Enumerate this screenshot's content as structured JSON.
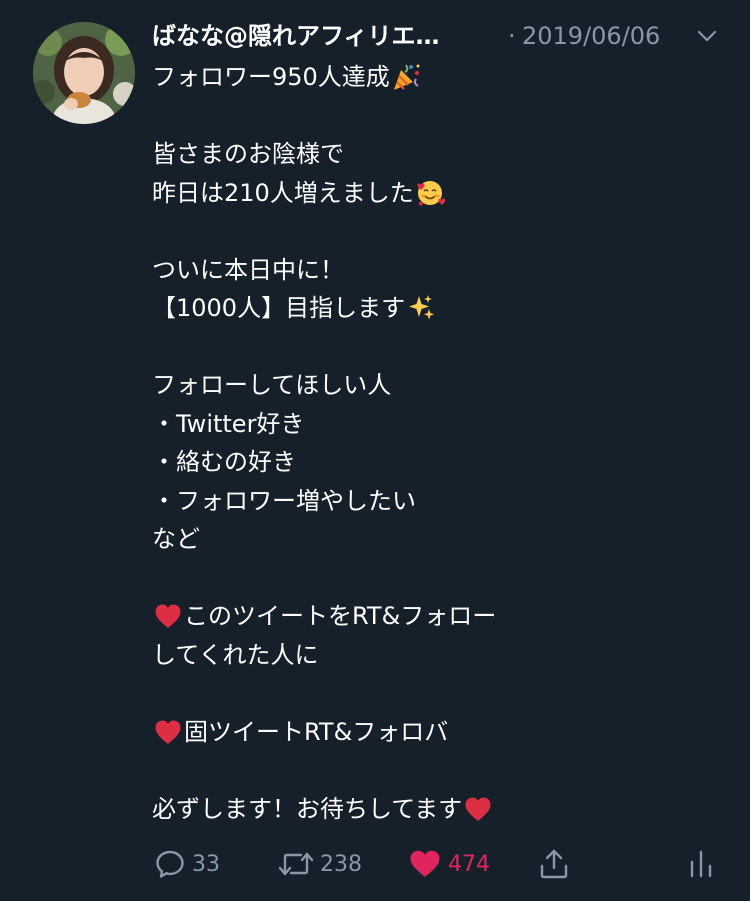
{
  "tweet": {
    "author": {
      "name": "ばなな@隠れアフィリエ…"
    },
    "separator": "·",
    "date": "2019/06/06",
    "lines": [
      {
        "text": "フォロワー950人達成",
        "emoji_after": "party-popper"
      },
      {
        "text": ""
      },
      {
        "text": "皆さまのお陰様で"
      },
      {
        "text": "昨日は210人増えました",
        "emoji_after": "smiling-face-with-hearts"
      },
      {
        "text": ""
      },
      {
        "text": "ついに本日中に！"
      },
      {
        "text": "【1000人】目指します",
        "emoji_after": "sparkles"
      },
      {
        "text": ""
      },
      {
        "text": "フォローしてほしい人"
      },
      {
        "text": "・Twitter好き"
      },
      {
        "text": "・絡むの好き"
      },
      {
        "text": "・フォロワー増やしたい"
      },
      {
        "text": "など"
      },
      {
        "text": ""
      },
      {
        "text": "このツイートをRT&フォロー",
        "emoji_before": "red-heart"
      },
      {
        "text": "してくれた人に"
      },
      {
        "text": ""
      },
      {
        "text": "固ツイートRT&フォロバ",
        "emoji_before": "red-heart"
      },
      {
        "text": ""
      },
      {
        "text": "必ずします！お待ちしてます",
        "emoji_after": "red-heart"
      }
    ],
    "actions": {
      "reply_count": "33",
      "retweet_count": "238",
      "like_count": "474"
    }
  },
  "colors": {
    "background": "#15202b",
    "text": "#ffffff",
    "muted": "#8899a6",
    "like": "#e0245e"
  },
  "icons": {
    "reply": "reply-icon",
    "retweet": "retweet-icon",
    "like": "heart-filled-icon",
    "share": "share-icon",
    "analytics": "analytics-icon",
    "menu": "chevron-down-icon"
  }
}
